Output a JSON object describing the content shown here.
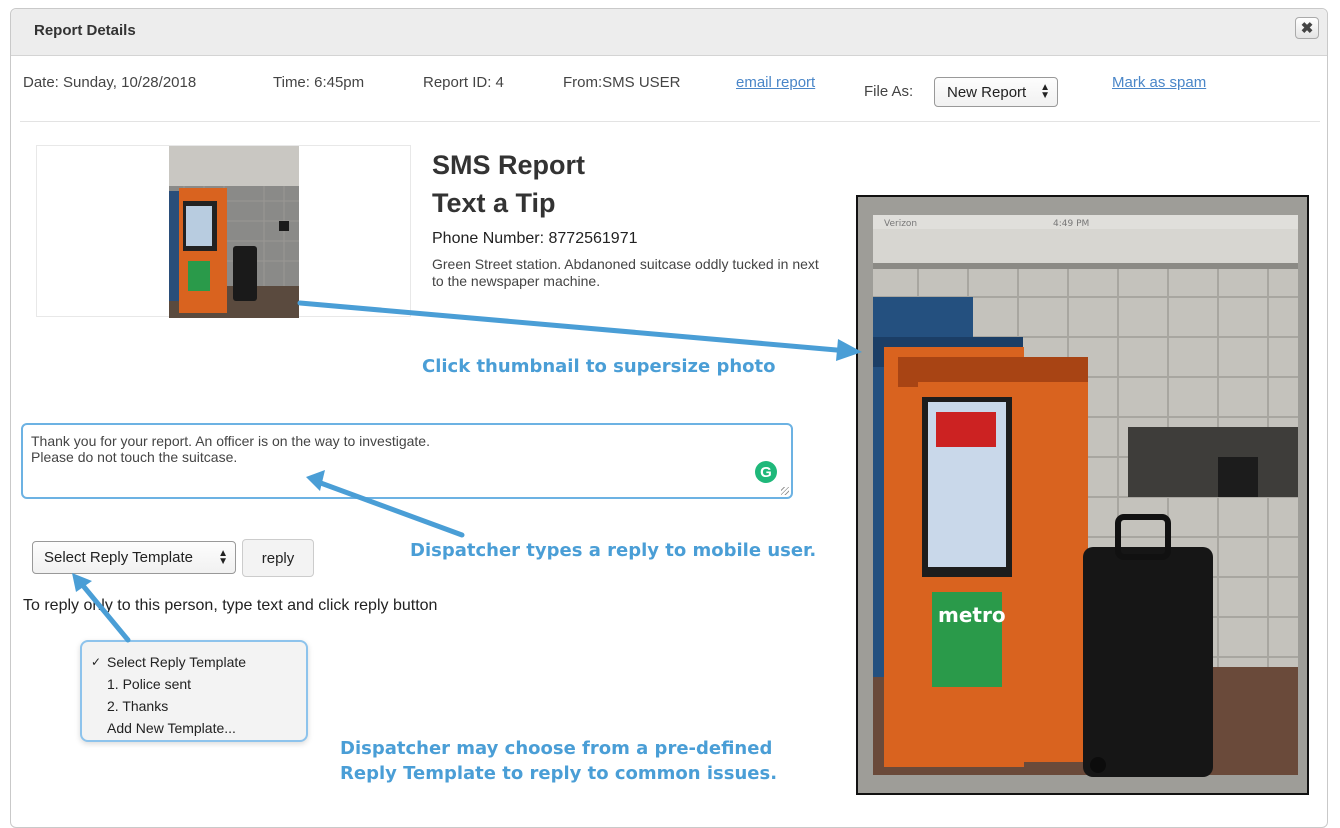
{
  "dialog": {
    "title": "Report Details",
    "close_icon": "close-icon"
  },
  "meta": {
    "date": "Date: Sunday, 10/28/2018",
    "time": "Time: 6:45pm",
    "report_id": "Report ID: 4",
    "from": "From:SMS USER",
    "email_link": "email report",
    "file_as_label": "File As:",
    "file_as_value": "New Report",
    "spam_link": "Mark as spam"
  },
  "report": {
    "heading": "SMS Report",
    "subheading": "Text a Tip",
    "phone": "Phone Number: 8772561971",
    "description": "Green Street station. Abdanoned suitcase oddly tucked in next to the newspaper machine."
  },
  "photo": {
    "status_carrier": "Verizon",
    "status_time": "4:49 PM",
    "newsbox_label": "metro"
  },
  "reply": {
    "text": "Thank you for your report. An officer is on the way to investigate.\nPlease do not touch the suitcase.",
    "grammarly_letter": "G",
    "template_select": "Select Reply Template",
    "reply_button": "reply",
    "instructions": "To reply only to this person, type text and click reply button"
  },
  "dropdown": {
    "items": [
      {
        "label": "Select Reply Template",
        "checked": true
      },
      {
        "label": "1. Police sent",
        "checked": false
      },
      {
        "label": "2. Thanks",
        "checked": false
      },
      {
        "label": "Add New Template...",
        "checked": false
      }
    ]
  },
  "annotations": {
    "thumbnail": "Click thumbnail to supersize photo",
    "reply": "Dispatcher types a reply to mobile user.",
    "template_line1": "Dispatcher may choose from a pre-defined",
    "template_line2": "Reply Template to reply to common issues."
  },
  "colors": {
    "annotation": "#4a9ed6",
    "link": "#4a86c8",
    "newsbox": "#d9631f"
  }
}
